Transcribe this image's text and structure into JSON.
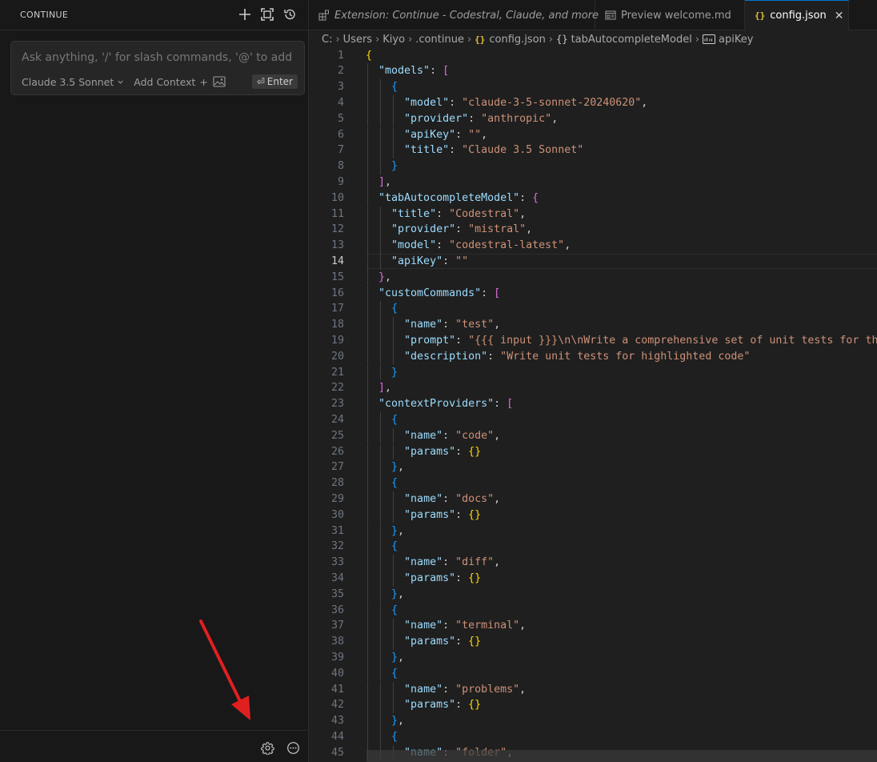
{
  "sidebar": {
    "title": "CONTINUE",
    "actions": [
      "plus-icon",
      "fullscreen-icon",
      "history-icon"
    ],
    "chat": {
      "placeholder": "Ask anything, '/' for slash commands, '@' to add cont",
      "model": "Claude 3.5 Sonnet",
      "add_context": "Add Context",
      "add_context_symbol": "+",
      "enter_symbol": "⏎",
      "enter": "Enter"
    },
    "footer_icons": [
      "gear-icon",
      "more-icon"
    ]
  },
  "tabs": [
    {
      "label": "Extension: Continue - Codestral, Claude, and more",
      "icon": "extensions-icon",
      "italic": true
    },
    {
      "label": "Preview welcome.md",
      "icon": "preview-icon",
      "italic": false
    },
    {
      "label": "config.json",
      "icon": "json-icon",
      "active": true,
      "close": "✕"
    }
  ],
  "breadcrumb": {
    "drive": "C:",
    "items": [
      "Users",
      "Kiyo",
      ".continue"
    ],
    "file": "config.json",
    "object": "tabAutocompleteModel",
    "field": "apiKey",
    "json_glyph": "{}"
  },
  "editor": {
    "current_line": 14,
    "lines": [
      {
        "n": 1,
        "text": "{"
      },
      {
        "n": 2,
        "text": "  \"models\": ["
      },
      {
        "n": 3,
        "text": "    {"
      },
      {
        "n": 4,
        "text": "      \"model\": \"claude-3-5-sonnet-20240620\","
      },
      {
        "n": 5,
        "text": "      \"provider\": \"anthropic\","
      },
      {
        "n": 6,
        "text": "      \"apiKey\": \"\","
      },
      {
        "n": 7,
        "text": "      \"title\": \"Claude 3.5 Sonnet\""
      },
      {
        "n": 8,
        "text": "    }"
      },
      {
        "n": 9,
        "text": "  ],"
      },
      {
        "n": 10,
        "text": "  \"tabAutocompleteModel\": {"
      },
      {
        "n": 11,
        "text": "    \"title\": \"Codestral\","
      },
      {
        "n": 12,
        "text": "    \"provider\": \"mistral\","
      },
      {
        "n": 13,
        "text": "    \"model\": \"codestral-latest\","
      },
      {
        "n": 14,
        "text": "    \"apiKey\": \"\""
      },
      {
        "n": 15,
        "text": "  },"
      },
      {
        "n": 16,
        "text": "  \"customCommands\": ["
      },
      {
        "n": 17,
        "text": "    {"
      },
      {
        "n": 18,
        "text": "      \"name\": \"test\","
      },
      {
        "n": 19,
        "text": "      \"prompt\": \"{{{ input }}}\\n\\nWrite a comprehensive set of unit tests for th"
      },
      {
        "n": 20,
        "text": "      \"description\": \"Write unit tests for highlighted code\""
      },
      {
        "n": 21,
        "text": "    }"
      },
      {
        "n": 22,
        "text": "  ],"
      },
      {
        "n": 23,
        "text": "  \"contextProviders\": ["
      },
      {
        "n": 24,
        "text": "    {"
      },
      {
        "n": 25,
        "text": "      \"name\": \"code\","
      },
      {
        "n": 26,
        "text": "      \"params\": {}"
      },
      {
        "n": 27,
        "text": "    },"
      },
      {
        "n": 28,
        "text": "    {"
      },
      {
        "n": 29,
        "text": "      \"name\": \"docs\","
      },
      {
        "n": 30,
        "text": "      \"params\": {}"
      },
      {
        "n": 31,
        "text": "    },"
      },
      {
        "n": 32,
        "text": "    {"
      },
      {
        "n": 33,
        "text": "      \"name\": \"diff\","
      },
      {
        "n": 34,
        "text": "      \"params\": {}"
      },
      {
        "n": 35,
        "text": "    },"
      },
      {
        "n": 36,
        "text": "    {"
      },
      {
        "n": 37,
        "text": "      \"name\": \"terminal\","
      },
      {
        "n": 38,
        "text": "      \"params\": {}"
      },
      {
        "n": 39,
        "text": "    },"
      },
      {
        "n": 40,
        "text": "    {"
      },
      {
        "n": 41,
        "text": "      \"name\": \"problems\","
      },
      {
        "n": 42,
        "text": "      \"params\": {}"
      },
      {
        "n": 43,
        "text": "    },"
      },
      {
        "n": 44,
        "text": "    {"
      },
      {
        "n": 45,
        "text": "      \"name\": \"folder\","
      }
    ]
  },
  "colors": {
    "key": "#9cdcfe",
    "string": "#ce9178",
    "bracket_depth1": "#ffd700",
    "bracket_depth2": "#da70d6",
    "bracket_depth3": "#179fff",
    "accent": "#0078d4",
    "annotation_arrow": "#e02020"
  }
}
